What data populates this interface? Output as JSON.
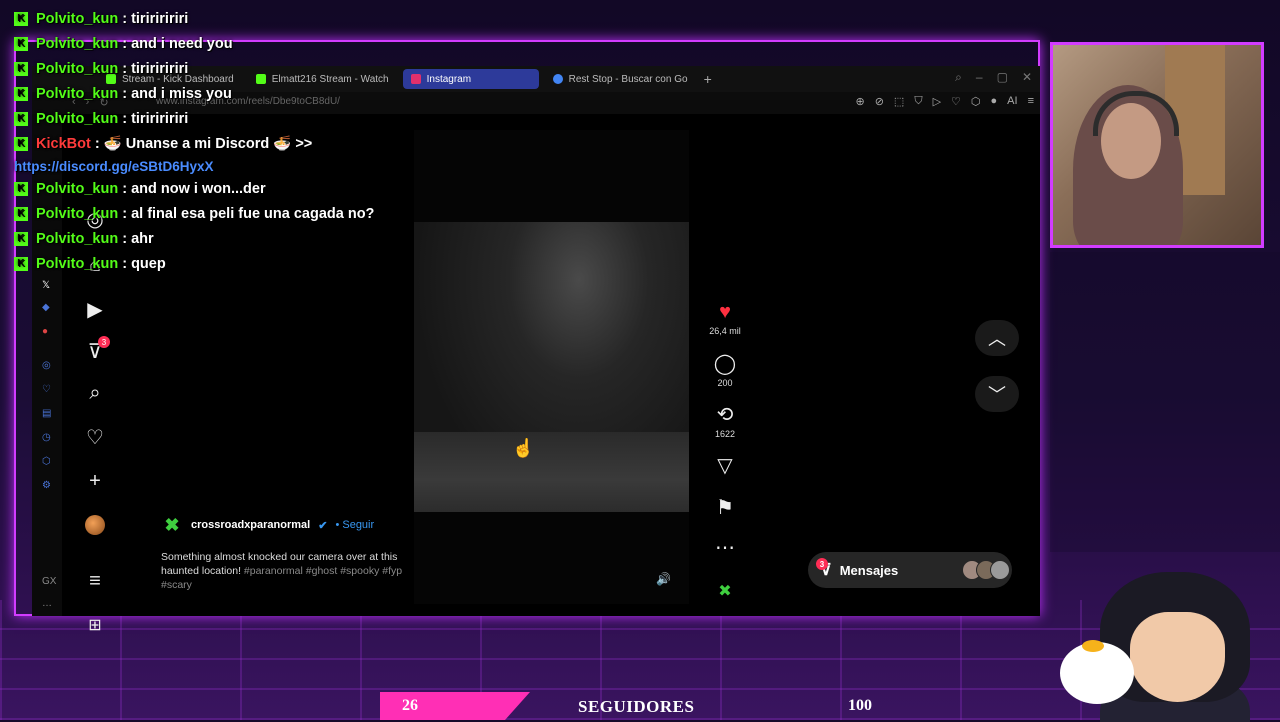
{
  "browser": {
    "tabs": [
      {
        "label": "Stream - Kick Dashboard",
        "fav_color": "#53fc18",
        "active": false
      },
      {
        "label": "Elmatt216 Stream - Watch",
        "fav_color": "#53fc18",
        "active": false
      },
      {
        "label": "Instagram",
        "fav_color": "#e1306c",
        "active": true
      },
      {
        "label": "Rest Stop - Buscar con Go",
        "fav_color": "#4285f4",
        "active": false
      }
    ],
    "url": "www.instagram.com/reels/Dbe9toCB8dU/"
  },
  "instagram": {
    "notifications_badge": "3",
    "reel": {
      "account": "crossroadxparanormal",
      "follow_label": "Seguir",
      "caption": "Something almost knocked our camera over at this haunted location!",
      "hashtags": "#paranormal #ghost #spooky #fyp #scary",
      "likes": "26,4 mil",
      "comments": "200",
      "reposts": "1622"
    },
    "messages_label": "Mensajes",
    "messages_badge": "3"
  },
  "chat": [
    {
      "user": "Polvito_kun",
      "text": ": tiririririri"
    },
    {
      "user": "Polvito_kun",
      "text": ": and i need you"
    },
    {
      "user": "Polvito_kun",
      "text": ": tiririririri"
    },
    {
      "user": "Polvito_kun",
      "text": ": and i miss you"
    },
    {
      "user": "Polvito_kun",
      "text": ": tiririririri"
    },
    {
      "user": "KickBot",
      "text": ": 🍜 Unanse a mi Discord 🍜 >>",
      "bot": true
    },
    {
      "link": "https://discord.gg/eSBtD6HyxX"
    },
    {
      "user": "Polvito_kun",
      "text": ": and now i won...der"
    },
    {
      "user": "Polvito_kun",
      "text": ": al final esa peli fue una cagada no?"
    },
    {
      "user": "Polvito_kun",
      "text": ": ahr"
    },
    {
      "user": "Polvito_kun",
      "text": ": quep"
    }
  ],
  "follower_goal": {
    "current": "26",
    "label": "SEGUIDORES",
    "goal": "100",
    "progress": 0.26
  },
  "colors": {
    "accent": "#d23cff",
    "kick_green": "#53fc18",
    "like_red": "#ff3040",
    "goal_pink": "#ff2fb5"
  }
}
